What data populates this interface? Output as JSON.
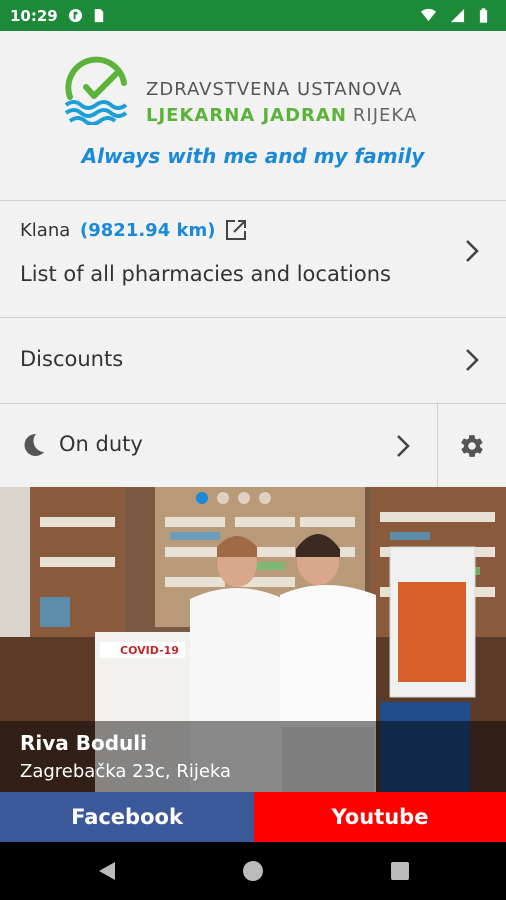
{
  "status_bar": {
    "time": "10:29"
  },
  "header": {
    "logo_line1": "ZDRAVSTVENA USTANOVA",
    "logo_line2_main": "LJEKARNA JADRAN",
    "logo_line2_city": "RIJEKA",
    "tagline": "Always with me and my family"
  },
  "pharmacies": {
    "location": "Klana",
    "distance": "(9821.94 km)",
    "label": "List of all pharmacies and locations"
  },
  "discounts": {
    "label": "Discounts"
  },
  "on_duty": {
    "label": "On duty"
  },
  "slideshow": {
    "pharmacy_name": "Riva Boduli",
    "address": "Zagrebačka 23c, Rijeka",
    "slide_count": 4,
    "active_slide": 0
  },
  "social": {
    "facebook": "Facebook",
    "youtube": "Youtube"
  },
  "colors": {
    "status_bar": "#1d8a3a",
    "accent_blue": "#1a8ad8",
    "brand_green": "#5bb33a",
    "facebook": "#3b5998",
    "youtube": "#ff0000"
  },
  "icons": [
    "wifi-icon",
    "battery-icon",
    "external-link-icon",
    "chevron-right-icon",
    "moon-icon",
    "gear-icon",
    "back-icon",
    "home-icon",
    "recents-icon"
  ]
}
